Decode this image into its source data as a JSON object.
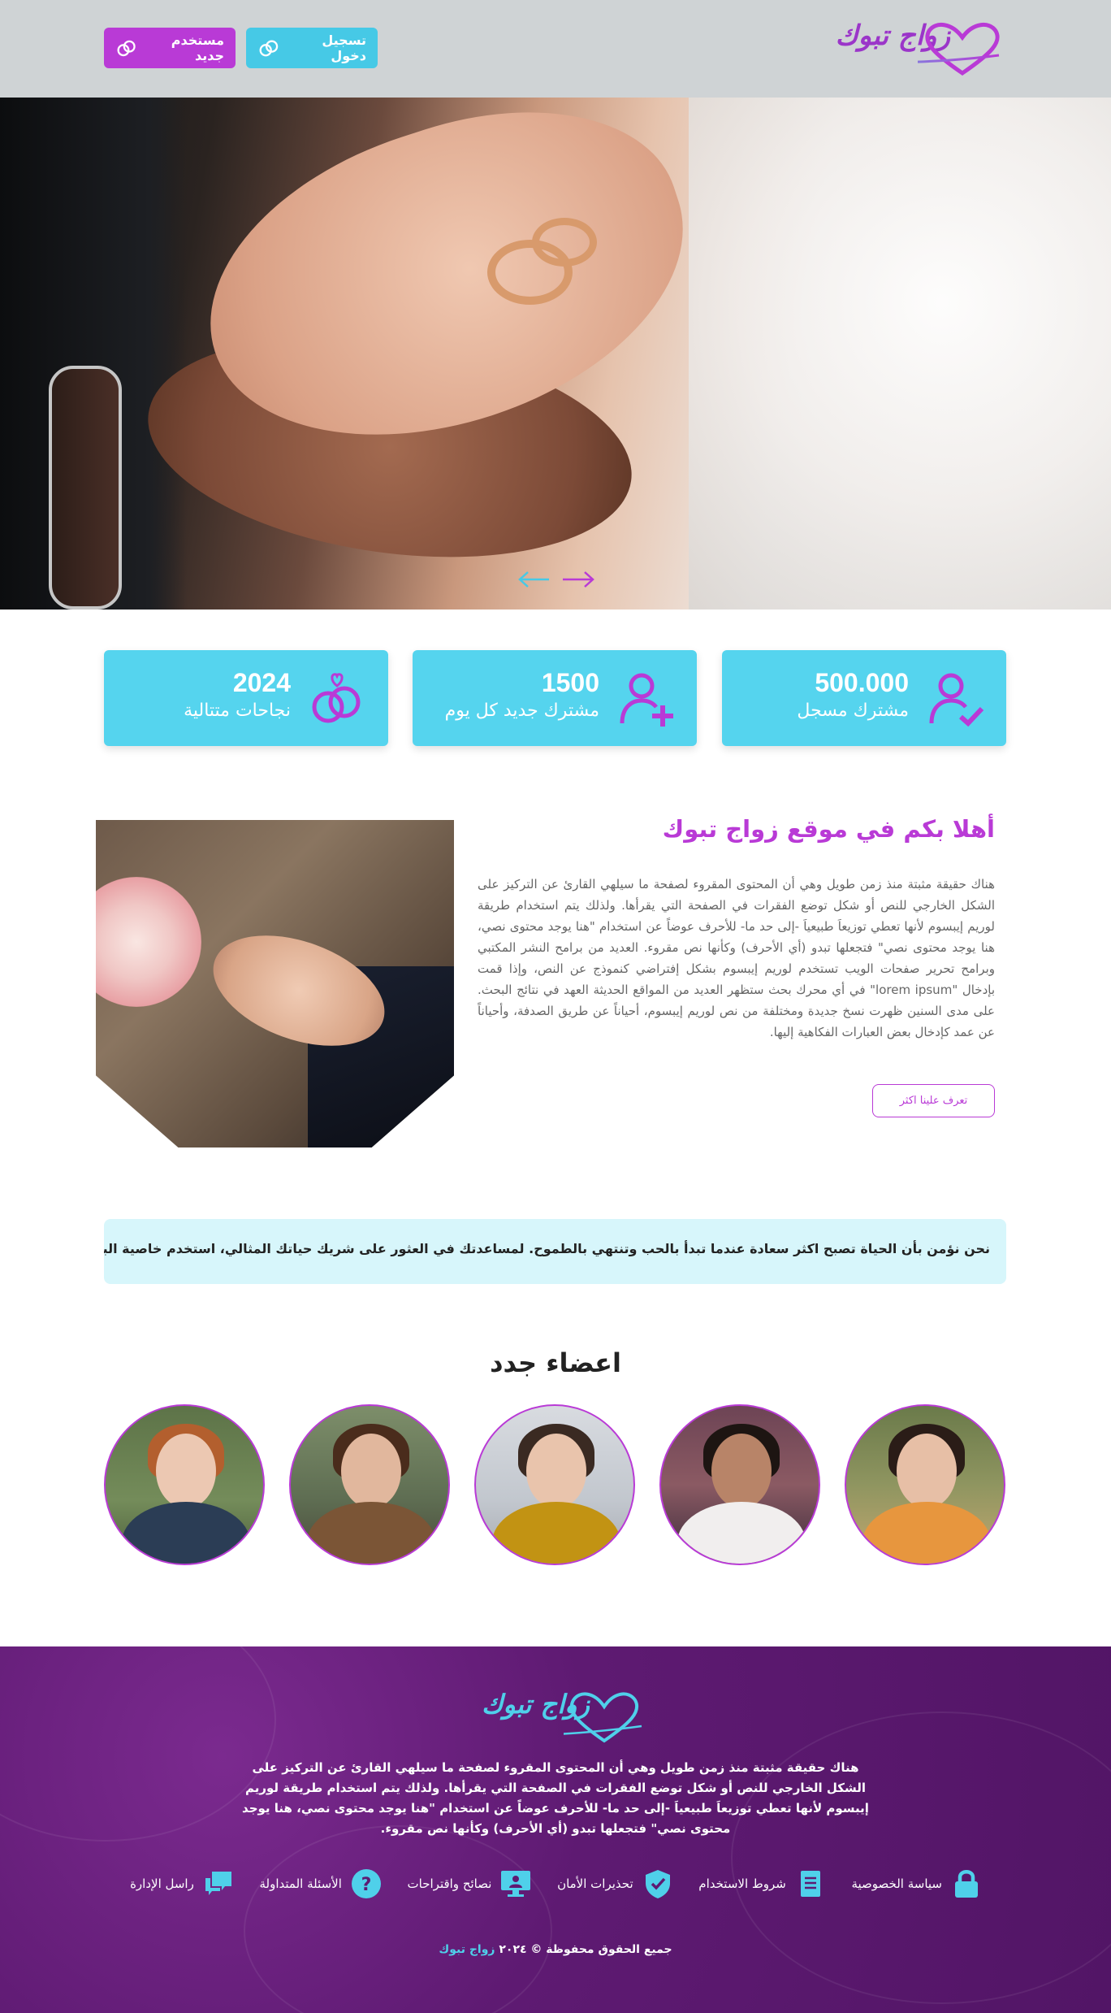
{
  "header": {
    "logo_text": "زواج تبوك",
    "login_label": "تسجيل دخول",
    "register_label": "مستخدم جديد"
  },
  "hero": {
    "icons": [
      "arrow-left-icon",
      "arrow-right-icon"
    ]
  },
  "stats": [
    {
      "number": "500.000",
      "label": "مشترك مسجل",
      "icon": "user-check-icon"
    },
    {
      "number": "1500",
      "label": "مشترك جديد كل يوم",
      "icon": "user-plus-icon"
    },
    {
      "number": "2024",
      "label": "نجاحات متتالية",
      "icon": "rings-heart-icon"
    }
  ],
  "about": {
    "title": "أهلا بكم في موقع زواج تبوك",
    "text": "هناك حقيقة مثبتة منذ زمن طويل وهي أن المحتوى المقروء لصفحة ما سيلهي القارئ عن التركيز على الشكل الخارجي للنص أو شكل توضع الفقرات في الصفحة التي يقرأها. ولذلك يتم استخدام طريقة لوريم إيبسوم لأنها تعطي توزيعاَ طبيعياَ -إلى حد ما- للأحرف عوضاً عن استخدام \"هنا يوجد محتوى نصي، هنا يوجد محتوى نصي\" فتجعلها تبدو (أي الأحرف) وكأنها نص مقروء. العديد من برامح النشر المكتبي وبرامح تحرير صفحات الويب تستخدم لوريم إيبسوم بشكل إفتراضي كنموذج عن النص، وإذا قمت بإدخال \"lorem ipsum\" في أي محرك بحث ستظهر العديد من المواقع الحديثة العهد في نتائج البحث. على مدى السنين ظهرت نسخ جديدة ومختلفة من نص لوريم إيبسوم، أحياناً عن طريق الصدفة، وأحياناً عن عمد كإدخال بعض العبارات الفكاهية إليها.",
    "button_label": "تعرف علينا اكثر"
  },
  "banner": {
    "text": "نحن نؤمن بأن الحياة تصبح اكثر سعادة عندما تبدأ بالحب وتنتهي بالطموح. لمساعدتك في العثور على شريك حياتك المثالي، استخدم خاصية البحث المتقدم التي تساعدك في"
  },
  "members": {
    "title": "اعضاء جدد"
  },
  "footer": {
    "logo_text": "زواج تبوك",
    "text": "هناك حقيقة مثبتة منذ زمن طويل وهي أن المحتوى المقروء لصفحة ما سيلهي القارئ عن التركيز على الشكل الخارجي للنص أو شكل توضع الفقرات في الصفحة التي يقرأها. ولذلك يتم استخدام طريقة لوريم إيبسوم لأنها تعطي توزيعاَ طبيعياَ -إلى حد ما- للأحرف عوضاً عن استخدام \"هنا يوجد محتوى نصي، هنا يوجد محتوى نصي\" فتجعلها تبدو (أي الأحرف) وكأنها نص مقروء.",
    "links": [
      {
        "label": "راسل الإدارة",
        "icon": "chat-icon"
      },
      {
        "label": "الأسئلة المتداولة",
        "icon": "question-icon"
      },
      {
        "label": "نصائح واقتراحات",
        "icon": "monitor-icon"
      },
      {
        "label": "تحذيرات الأمان",
        "icon": "shield-check-icon"
      },
      {
        "label": "شروط الاستخدام",
        "icon": "document-icon"
      },
      {
        "label": "سياسة الخصوصية",
        "icon": "lock-icon"
      }
    ],
    "copyright_prefix": "جميع الحقوق محفوظة © ٢٠٢٤",
    "copyright_brand": "زواج تبوك"
  },
  "colors": {
    "primary_purple": "#b93ad6",
    "primary_cyan": "#55d4ee",
    "footer_purple": "#5e1a72"
  }
}
